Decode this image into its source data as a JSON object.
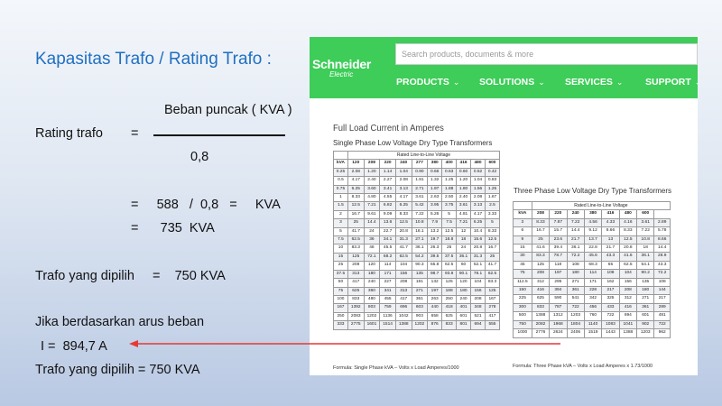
{
  "slide": {
    "title": "Kapasitas Trafo / Rating Trafo :",
    "numerator": "Beban puncak ( KVA )",
    "rating_label": "Rating trafo",
    "eq1": "=",
    "denominator": "0,8",
    "line1": "=     588   /  0,8   =     KVA",
    "line2": "=      735  KVA",
    "chosen1": "Trafo yang dipilih     =    750 KVA",
    "current_intro": "Jika berdasarkan arus beban",
    "current_value": "I =  894,7 A",
    "chosen2": "Trafo yang dipilih = 750 KVA",
    "arrow_color": "#e53935"
  },
  "site": {
    "brand": "Schneider",
    "brand_sub": "Electric",
    "brand_color": "#3dcd58",
    "search_placeholder": "Search products, documents & more",
    "nav": [
      "PRODUCTS",
      "SOLUTIONS",
      "SERVICES",
      "SUPPORT"
    ],
    "chevron_icon": "chevron-down-icon"
  },
  "doc": {
    "title": "Full Load Current in Amperes",
    "single_title": "Single Phase Low Voltage Dry Type Transformers",
    "three_title": "Three Phase Low Voltage Dry Type Transformers",
    "rated_caption": "Rated Line-to-Line Voltage",
    "single_headers": [
      "kVA",
      "120",
      "208",
      "220",
      "240",
      "277",
      "380",
      "400",
      "416",
      "480",
      "600"
    ],
    "single_rows": [
      [
        "0.25",
        "2.08",
        "1.20",
        "1.14",
        "1.04",
        "0.90",
        "0.66",
        "0.63",
        "0.60",
        "0.52",
        "0.42"
      ],
      [
        "0.5",
        "4.17",
        "2.40",
        "2.27",
        "2.08",
        "1.81",
        "1.32",
        "1.25",
        "1.20",
        "1.04",
        "0.83"
      ],
      [
        "0.75",
        "6.25",
        "3.60",
        "3.41",
        "3.13",
        "2.71",
        "1.97",
        "1.88",
        "1.80",
        "1.56",
        "1.25"
      ],
      [
        "1",
        "8.33",
        "4.80",
        "4.55",
        "4.17",
        "3.61",
        "2.63",
        "2.50",
        "2.40",
        "2.08",
        "1.67"
      ],
      [
        "1.5",
        "12.5",
        "7.21",
        "6.82",
        "6.25",
        "5.42",
        "3.95",
        "3.75",
        "3.61",
        "3.13",
        "2.5"
      ],
      [
        "2",
        "16.7",
        "9.61",
        "9.09",
        "8.33",
        "7.22",
        "5.26",
        "5",
        "4.81",
        "4.17",
        "3.33"
      ],
      [
        "3",
        "25",
        "14.4",
        "13.6",
        "12.5",
        "10.8",
        "7.9",
        "7.5",
        "7.21",
        "6.25",
        "5"
      ],
      [
        "5",
        "41.7",
        "24",
        "22.7",
        "20.8",
        "18.1",
        "13.2",
        "12.5",
        "12",
        "10.4",
        "8.33"
      ],
      [
        "7.5",
        "62.5",
        "36",
        "34.1",
        "31.3",
        "27.1",
        "19.7",
        "18.8",
        "18",
        "15.6",
        "12.5"
      ],
      [
        "10",
        "83.3",
        "48",
        "45.5",
        "41.7",
        "36.1",
        "26.3",
        "25",
        "24",
        "20.8",
        "16.7"
      ],
      [
        "15",
        "125",
        "72.1",
        "68.2",
        "62.5",
        "54.2",
        "39.5",
        "37.5",
        "36.1",
        "31.3",
        "25"
      ],
      [
        "25",
        "208",
        "120",
        "114",
        "104",
        "90.3",
        "65.8",
        "62.5",
        "60",
        "52.1",
        "41.7"
      ],
      [
        "37.5",
        "313",
        "180",
        "171",
        "156",
        "135",
        "98.7",
        "93.8",
        "90.1",
        "78.1",
        "62.5"
      ],
      [
        "50",
        "417",
        "240",
        "227",
        "208",
        "181",
        "132",
        "125",
        "120",
        "104",
        "83.3"
      ],
      [
        "75",
        "625",
        "360",
        "341",
        "313",
        "271",
        "197",
        "188",
        "180",
        "156",
        "125"
      ],
      [
        "100",
        "833",
        "480",
        "455",
        "417",
        "361",
        "263",
        "250",
        "240",
        "208",
        "167"
      ],
      [
        "167",
        "1392",
        "803",
        "759",
        "696",
        "603",
        "440",
        "418",
        "401",
        "348",
        "278"
      ],
      [
        "250",
        "2083",
        "1202",
        "1136",
        "1042",
        "903",
        "658",
        "625",
        "601",
        "521",
        "417"
      ],
      [
        "333",
        "2775",
        "1601",
        "1514",
        "1388",
        "1202",
        "876",
        "833",
        "801",
        "694",
        "555"
      ]
    ],
    "three_headers": [
      "kVA",
      "208",
      "220",
      "240",
      "380",
      "416",
      "480",
      "600"
    ],
    "three_rows": [
      [
        "3",
        "8.33",
        "7.87",
        "7.22",
        "4.56",
        "4.33",
        "4.16",
        "3.61",
        "2.89"
      ],
      [
        "6",
        "16.7",
        "15.7",
        "14.4",
        "9.12",
        "8.66",
        "8.33",
        "7.22",
        "5.78"
      ],
      [
        "9",
        "25",
        "23.6",
        "21.7",
        "13.7",
        "13",
        "12.5",
        "10.8",
        "8.66"
      ],
      [
        "15",
        "41.6",
        "39.4",
        "36.1",
        "22.8",
        "21.7",
        "20.8",
        "18",
        "14.4"
      ],
      [
        "30",
        "83.3",
        "78.7",
        "72.2",
        "45.6",
        "43.3",
        "41.6",
        "36.1",
        "28.9"
      ],
      [
        "45",
        "125",
        "118",
        "108",
        "68.3",
        "65",
        "62.5",
        "54.1",
        "43.3"
      ],
      [
        "75",
        "208",
        "197",
        "180",
        "114",
        "108",
        "104",
        "90.2",
        "72.2"
      ],
      [
        "112.5",
        "312",
        "295",
        "271",
        "171",
        "162",
        "156",
        "135",
        "108"
      ],
      [
        "150",
        "416",
        "394",
        "361",
        "228",
        "217",
        "208",
        "180",
        "144"
      ],
      [
        "225",
        "625",
        "590",
        "541",
        "342",
        "325",
        "312",
        "271",
        "217"
      ],
      [
        "300",
        "833",
        "787",
        "722",
        "456",
        "433",
        "416",
        "361",
        "289"
      ],
      [
        "500",
        "1388",
        "1312",
        "1203",
        "760",
        "722",
        "694",
        "601",
        "481"
      ],
      [
        "750",
        "2082",
        "1968",
        "1804",
        "1140",
        "1083",
        "1041",
        "902",
        "722"
      ],
      [
        "1000",
        "2776",
        "2624",
        "2406",
        "1519",
        "1443",
        "1388",
        "1203",
        "962"
      ]
    ],
    "single_formula": "Formula: Single Phase kVA – Volts x Load Amperes/1000",
    "three_formula": "Formula: Three Phase kVA – Volts x Load Amperes x 1.73/1000"
  }
}
